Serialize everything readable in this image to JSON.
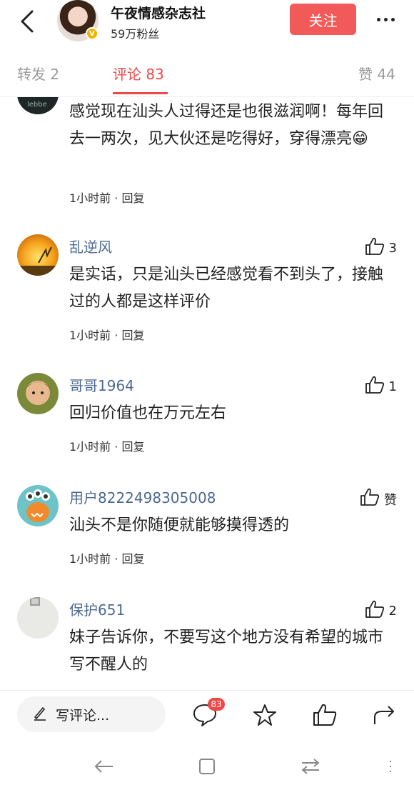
{
  "header": {
    "title": "午夜情感杂志社",
    "fans": "59万粉丝",
    "verified_badge": "V",
    "follow_label": "关注"
  },
  "tabs": [
    {
      "label": "转发 2",
      "active": false
    },
    {
      "label": "评论 83",
      "active": true
    },
    {
      "label": "赞 44",
      "active": false
    }
  ],
  "comments": [
    {
      "user": "",
      "text": "感觉现在汕头人过得还是也很滋润啊！每年回去一两次，见大伙还是吃得好，穿得漂亮😁",
      "meta": "1小时前 · 回复",
      "likes": ""
    },
    {
      "user": "乱逆风",
      "text": "是实话，只是汕头已经感觉看不到头了，接触过的人都是这样评价",
      "meta": "1小时前 · 回复",
      "likes": "3"
    },
    {
      "user": "哥哥1964",
      "text": "回归价值也在万元左右",
      "meta": "1小时前 · 回复",
      "likes": "1"
    },
    {
      "user": "用户8222498305008",
      "text": "汕头不是你随便就能够摸得透的",
      "meta": "1小时前 · 回复",
      "likes": "赞"
    },
    {
      "user": "保护651",
      "text": "妹子告诉你，不要写这个地方没有希望的城市写不醒人的",
      "meta": "",
      "likes": "2"
    }
  ],
  "bottom_bar": {
    "write_placeholder": "写评论...",
    "comment_count_badge": "83"
  },
  "colors": {
    "accent": "#f04848",
    "follow_button": "#f25a5a",
    "username": "#4c6a91"
  },
  "icons": [
    "back-arrow-icon",
    "more-dots-icon",
    "thumb-up-icon",
    "pen-icon",
    "comment-bubble-icon",
    "star-icon",
    "share-arrow-icon",
    "nav-back-icon",
    "nav-home-icon",
    "nav-recents-icon",
    "nav-menu-icon"
  ]
}
